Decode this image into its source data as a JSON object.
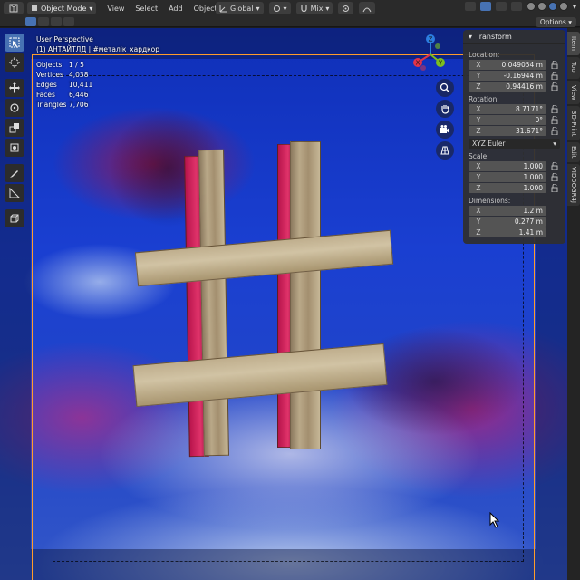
{
  "header": {
    "mode": "Object Mode",
    "menus": [
      "View",
      "Select",
      "Add",
      "Object"
    ],
    "orientation": "Global",
    "proportional": "Mix",
    "options_label": "Options"
  },
  "viewport": {
    "view_name": "User Perspective",
    "collection_line": "(1) АНТАЙТЛД | #металік_хардкор",
    "stats": [
      {
        "label": "Objects",
        "value": "1 / 5"
      },
      {
        "label": "Vertices",
        "value": "4,038"
      },
      {
        "label": "Edges",
        "value": "10,411"
      },
      {
        "label": "Faces",
        "value": "6,446"
      },
      {
        "label": "Triangles",
        "value": "7,706"
      }
    ],
    "gizmo": {
      "x": "X",
      "y": "Y",
      "z": "Z"
    }
  },
  "transform": {
    "title": "Transform",
    "location_label": "Location:",
    "location": [
      {
        "axis": "X",
        "value": "0.049054 m"
      },
      {
        "axis": "Y",
        "value": "-0.16944 m"
      },
      {
        "axis": "Z",
        "value": "0.94416 m"
      }
    ],
    "rotation_label": "Rotation:",
    "rotation": [
      {
        "axis": "X",
        "value": "8.7171°"
      },
      {
        "axis": "Y",
        "value": "0°"
      },
      {
        "axis": "Z",
        "value": "31.671°"
      }
    ],
    "rotation_mode": "XYZ Euler",
    "scale_label": "Scale:",
    "scale": [
      {
        "axis": "X",
        "value": "1.000"
      },
      {
        "axis": "Y",
        "value": "1.000"
      },
      {
        "axis": "Z",
        "value": "1.000"
      }
    ],
    "dimensions_label": "Dimensions:",
    "dimensions": [
      {
        "axis": "X",
        "value": "1.2 m"
      },
      {
        "axis": "Y",
        "value": "0.277 m"
      },
      {
        "axis": "Z",
        "value": "1.41 m"
      }
    ]
  },
  "sidebar_tabs": [
    "Item",
    "Tool",
    "View",
    "3D-Print",
    "Edit",
    "VIDDOGR4J"
  ],
  "colors": {
    "accent": "#4772b3",
    "camera_frame": "#ff9c2a"
  }
}
